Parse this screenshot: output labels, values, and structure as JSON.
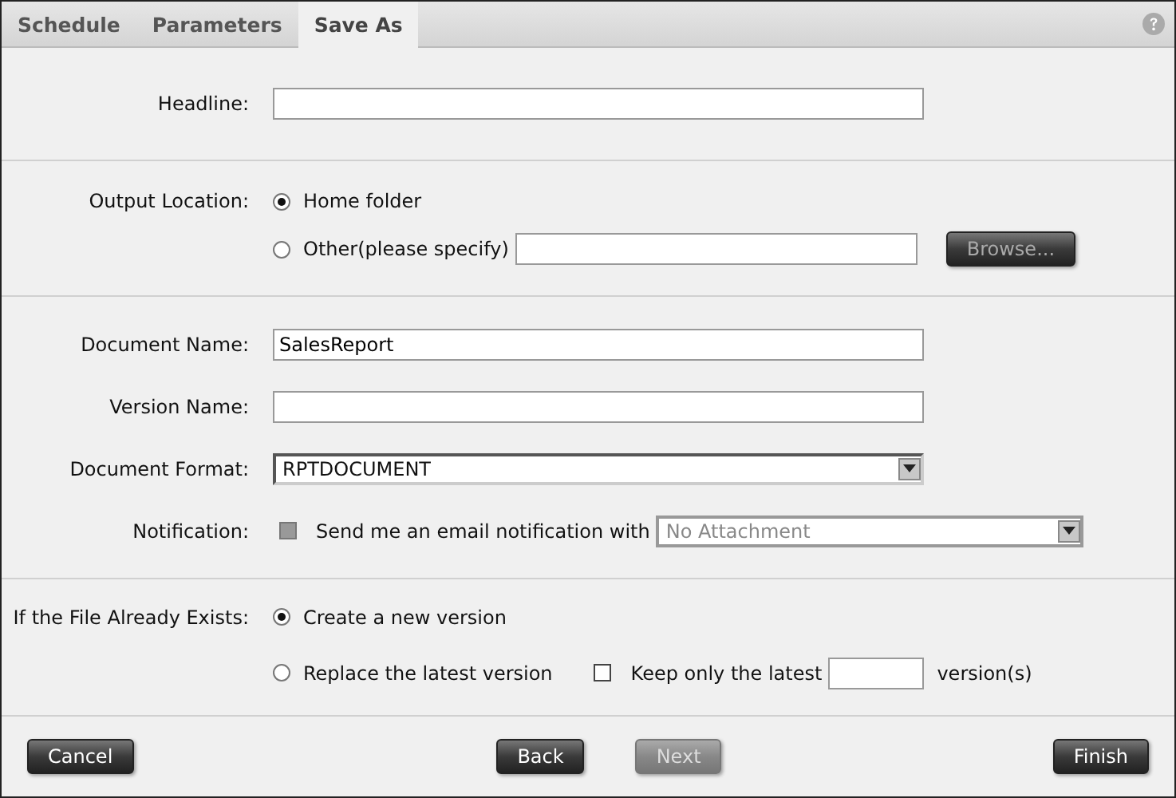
{
  "tabs": [
    {
      "label": "Schedule",
      "selected": false
    },
    {
      "label": "Parameters",
      "selected": false
    },
    {
      "label": "Save As",
      "selected": true
    }
  ],
  "headline": {
    "label": "Headline:"
  },
  "output_location": {
    "label": "Output Location:",
    "options": [
      {
        "label": "Home folder",
        "selected": true
      },
      {
        "label": "Other(please specify)",
        "selected": false
      }
    ],
    "browse_button": {
      "label": "Browse...",
      "disabled": true
    }
  },
  "document_name": {
    "label": "Document Name:",
    "value": "SalesReport"
  },
  "version_name": {
    "label": "Version Name:"
  },
  "document_format": {
    "label": "Document Format:",
    "value": "RPTDOCUMENT",
    "disabled": false
  },
  "notification": {
    "label": "Notification:",
    "checkbox_label": "Send me an email notification with",
    "checked": false,
    "disabled": true,
    "attachment": {
      "value": "No Attachment",
      "disabled": true
    }
  },
  "if_exists": {
    "label": "If the File Already Exists:",
    "options": [
      {
        "label": "Create a new version",
        "selected": true
      },
      {
        "label": "Replace the latest version",
        "selected": false
      }
    ],
    "keep_latest": {
      "label": "Keep only the latest",
      "suffix": "version(s)",
      "checked": false
    }
  },
  "buttons": [
    {
      "label": "Cancel",
      "disabled": false
    },
    {
      "label": "Back",
      "disabled": false
    },
    {
      "label": "Next",
      "disabled": true
    },
    {
      "label": "Finish",
      "disabled": false
    }
  ]
}
